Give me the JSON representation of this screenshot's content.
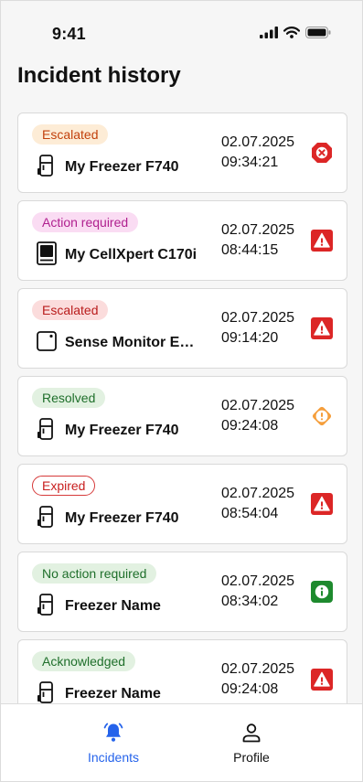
{
  "status_bar": {
    "time": "9:41"
  },
  "page": {
    "title": "Incident history"
  },
  "colors": {
    "accent": "#2563eb",
    "severity_red": "#dc2626",
    "severity_orange": "#f59e3b",
    "severity_green": "#1e8a2e"
  },
  "incidents": [
    {
      "badge": "Escalated",
      "badge_style": "escalated-orange",
      "device_icon": "freezer-icon",
      "device": "My Freezer F740",
      "date": "02.07.2025",
      "time": "09:34:21",
      "severity_icon": "error-icon"
    },
    {
      "badge": "Action required",
      "badge_style": "action-required",
      "device_icon": "incubator-icon",
      "device": "My CellXpert C170i",
      "date": "02.07.2025",
      "time": "08:44:15",
      "severity_icon": "warning-icon"
    },
    {
      "badge": "Escalated",
      "badge_style": "escalated-red",
      "device_icon": "sensor-icon",
      "device": "Sense Monitor ESS...",
      "date": "02.07.2025",
      "time": "09:14:20",
      "severity_icon": "warning-icon"
    },
    {
      "badge": "Resolved",
      "badge_style": "resolved",
      "device_icon": "freezer-icon",
      "device": "My Freezer F740",
      "date": "02.07.2025",
      "time": "09:24:08",
      "severity_icon": "caution-icon"
    },
    {
      "badge": "Expired",
      "badge_style": "expired",
      "device_icon": "freezer-icon",
      "device": "My Freezer F740",
      "date": "02.07.2025",
      "time": "08:54:04",
      "severity_icon": "warning-icon"
    },
    {
      "badge": "No action required",
      "badge_style": "no-action",
      "device_icon": "freezer-icon",
      "device": "Freezer Name",
      "date": "02.07.2025",
      "time": "08:34:02",
      "severity_icon": "info-icon"
    },
    {
      "badge": "Acknowledged",
      "badge_style": "acknowledged",
      "device_icon": "freezer-icon",
      "device": "Freezer Name",
      "date": "02.07.2025",
      "time": "09:24:08",
      "severity_icon": "warning-icon"
    }
  ],
  "bottom_nav": {
    "items": [
      {
        "label": "Incidents",
        "icon": "bell-icon",
        "active": true
      },
      {
        "label": "Profile",
        "icon": "person-icon",
        "active": false
      }
    ]
  }
}
